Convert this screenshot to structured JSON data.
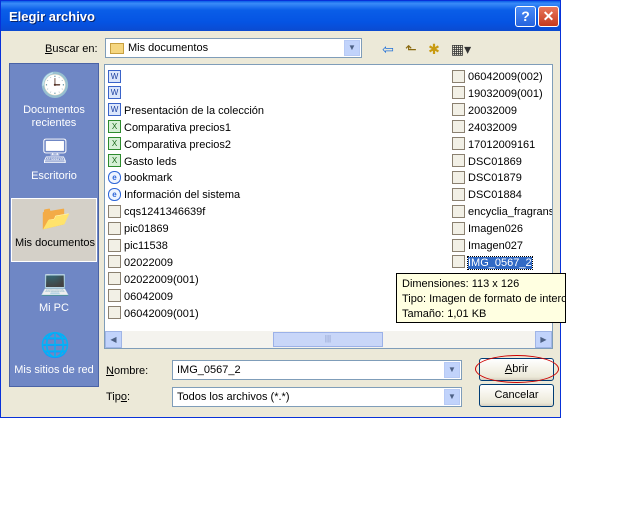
{
  "window": {
    "title": "Elegir archivo",
    "help_glyph": "?",
    "close_glyph": "✕"
  },
  "toolbar": {
    "lookin_label_prefix": "B",
    "lookin_label_rest": "uscar en:",
    "lookin_value": "Mis documentos"
  },
  "places": [
    {
      "label": "Documentos recientes"
    },
    {
      "label": "Escritorio"
    },
    {
      "label": "Mis documentos"
    },
    {
      "label": "Mi PC"
    },
    {
      "label": "Mis sitios de red"
    }
  ],
  "files_col1": [
    {
      "name": "",
      "type": "word"
    },
    {
      "name": "",
      "type": "word"
    },
    {
      "name": "Presentación de la colección",
      "type": "word"
    },
    {
      "name": "Comparativa precios1",
      "type": "excel"
    },
    {
      "name": "Comparativa precios2",
      "type": "excel"
    },
    {
      "name": "Gasto leds",
      "type": "excel"
    },
    {
      "name": "bookmark",
      "type": "ie"
    },
    {
      "name": "Información del sistema",
      "type": "ie"
    },
    {
      "name": "cqs1241346639f",
      "type": "img"
    },
    {
      "name": "pic01869",
      "type": "img"
    },
    {
      "name": "pic11538",
      "type": "img"
    },
    {
      "name": "02022009",
      "type": "img"
    },
    {
      "name": "02022009(001)",
      "type": "img"
    },
    {
      "name": "06042009",
      "type": "img"
    },
    {
      "name": "06042009(001)",
      "type": "img"
    }
  ],
  "files_col2": [
    {
      "name": "06042009(002)",
      "type": "img"
    },
    {
      "name": "19032009(001)",
      "type": "img"
    },
    {
      "name": "20032009",
      "type": "img"
    },
    {
      "name": "24032009",
      "type": "img"
    },
    {
      "name": "17012009161",
      "type": "img"
    },
    {
      "name": "DSC01869",
      "type": "img"
    },
    {
      "name": "DSC01879",
      "type": "img"
    },
    {
      "name": "DSC01884",
      "type": "img"
    },
    {
      "name": "encyclia_fragrans",
      "type": "img"
    },
    {
      "name": "Imagen026",
      "type": "img"
    },
    {
      "name": "Imagen027",
      "type": "img"
    },
    {
      "name": "IMG_0567_2",
      "type": "img",
      "selected": true
    }
  ],
  "tooltip": {
    "line1": "Dimensiones: 113 x 126",
    "line2": "Tipo: Imagen de formato de intercambio",
    "line3": "Tamaño: 1,01 KB"
  },
  "filename": {
    "label_prefix": "N",
    "label_rest": "ombre:",
    "value": "IMG_0567_2"
  },
  "filetype": {
    "label_prefix": "Tip",
    "label_u": "o",
    "label_rest": ":",
    "value": "Todos los archivos (*.*)"
  },
  "buttons": {
    "open_u": "A",
    "open_rest": "brir",
    "cancel": "Cancelar"
  },
  "icons": {
    "back": "⇦",
    "up": "⬑",
    "new_folder": "✱",
    "view": "▦▾",
    "dropdown": "▼",
    "scroll_left": "◀",
    "scroll_right": "▶",
    "thumb_grip": "|||"
  },
  "colors": {
    "titlebar": "#0a5ee8",
    "places_bg": "#6f87c5",
    "selection": "#316ac5",
    "annotation": "#cc0000"
  }
}
